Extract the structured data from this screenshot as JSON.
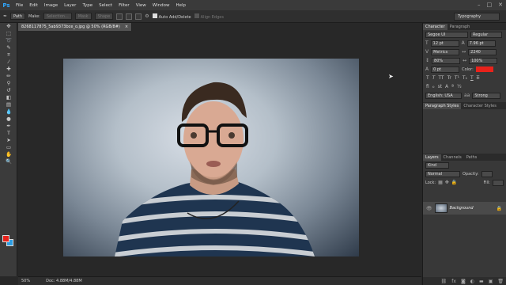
{
  "app": {
    "logo": "Ps"
  },
  "menu": [
    "File",
    "Edit",
    "Image",
    "Layer",
    "Type",
    "Select",
    "Filter",
    "View",
    "Window",
    "Help"
  ],
  "window_controls": {
    "minimize": "–",
    "maximize": "□",
    "close": "✕"
  },
  "options_bar": {
    "path_mode": "Path",
    "make_label": "Make:",
    "selection_btn": "Selection...",
    "mask_btn": "Mask",
    "shape_btn": "Shape",
    "auto_add_delete": "Auto Add/Delete",
    "align_edges": "Align Edges"
  },
  "workspace": "Typography",
  "document_tab": {
    "title": "8268117875_5ab9373bce_o.jpg @ 50% (RGB/8#)",
    "close": "×"
  },
  "status": {
    "zoom": "50%",
    "doc": "Doc: 4.88M/4.88M"
  },
  "character_panel": {
    "tabs": [
      "Character",
      "Paragraph"
    ],
    "font_family": "Segoe UI",
    "font_style": "Regular",
    "font_size": "12 pt",
    "leading": "7.96 pt",
    "kerning": "Metrics",
    "tracking": "2240",
    "vscale": "80%",
    "hscale": "100%",
    "baseline": "0 pt",
    "color_label": "Color:",
    "color": "#e8221b",
    "type_styles": [
      "T",
      "T",
      "TT",
      "Tr",
      "T¹",
      "T₁",
      "T",
      "T"
    ],
    "language": "English: USA",
    "aa_mode": "Strong"
  },
  "styles_panel": {
    "tabs": [
      "Paragraph Styles",
      "Character Styles"
    ]
  },
  "layers_panel": {
    "tabs": [
      "Layers",
      "Channels",
      "Paths"
    ],
    "kind": "Kind",
    "blend": "Normal",
    "opacity_label": "Opacity:",
    "lock_label": "Lock:",
    "fill_label": "Fill:",
    "layer_name": "Background"
  },
  "photo": {
    "alt": "Portrait of a young man with black glasses and a striped sweater"
  }
}
